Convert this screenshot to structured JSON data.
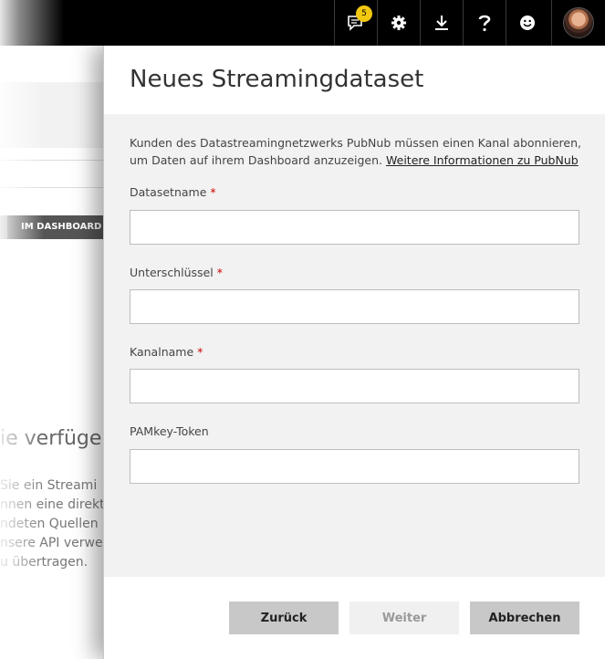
{
  "topbar": {
    "notification_count": "5",
    "icons": [
      "notifications-icon",
      "settings-gear-icon",
      "download-icon",
      "help-question-icon",
      "feedback-smiley-icon",
      "user-avatar"
    ]
  },
  "background_page": {
    "button_label": "IM DASHBOARD V",
    "heading": "ie verfüger",
    "paragraph_lines": [
      "Sie ein Streami",
      "nnen eine direkt",
      "ndeten Quellen",
      "nsere API verwe",
      "u übertragen."
    ]
  },
  "panel": {
    "title": "Neues Streamingdataset",
    "description": "Kunden des Datastreamingnetzwerks PubNub müssen einen Kanal abonnieren, um Daten auf ihrem Dashboard anzuzeigen.",
    "link_text": "Weitere Informationen zu PubNub",
    "fields": [
      {
        "label": "Datasetname",
        "required_mark": "*",
        "value": ""
      },
      {
        "label": "Unterschlüssel",
        "required_mark": "*",
        "value": ""
      },
      {
        "label": "Kanalname",
        "required_mark": "*",
        "value": ""
      },
      {
        "label": "PAMkey-Token",
        "required_mark": "",
        "value": ""
      }
    ],
    "buttons": {
      "back": "Zurück",
      "next": "Weiter",
      "cancel": "Abbrechen"
    }
  },
  "colors": {
    "topbar": "#000000",
    "badge": "#f2c811",
    "required": "#cc0000",
    "panel_body": "#f2f2f2"
  }
}
